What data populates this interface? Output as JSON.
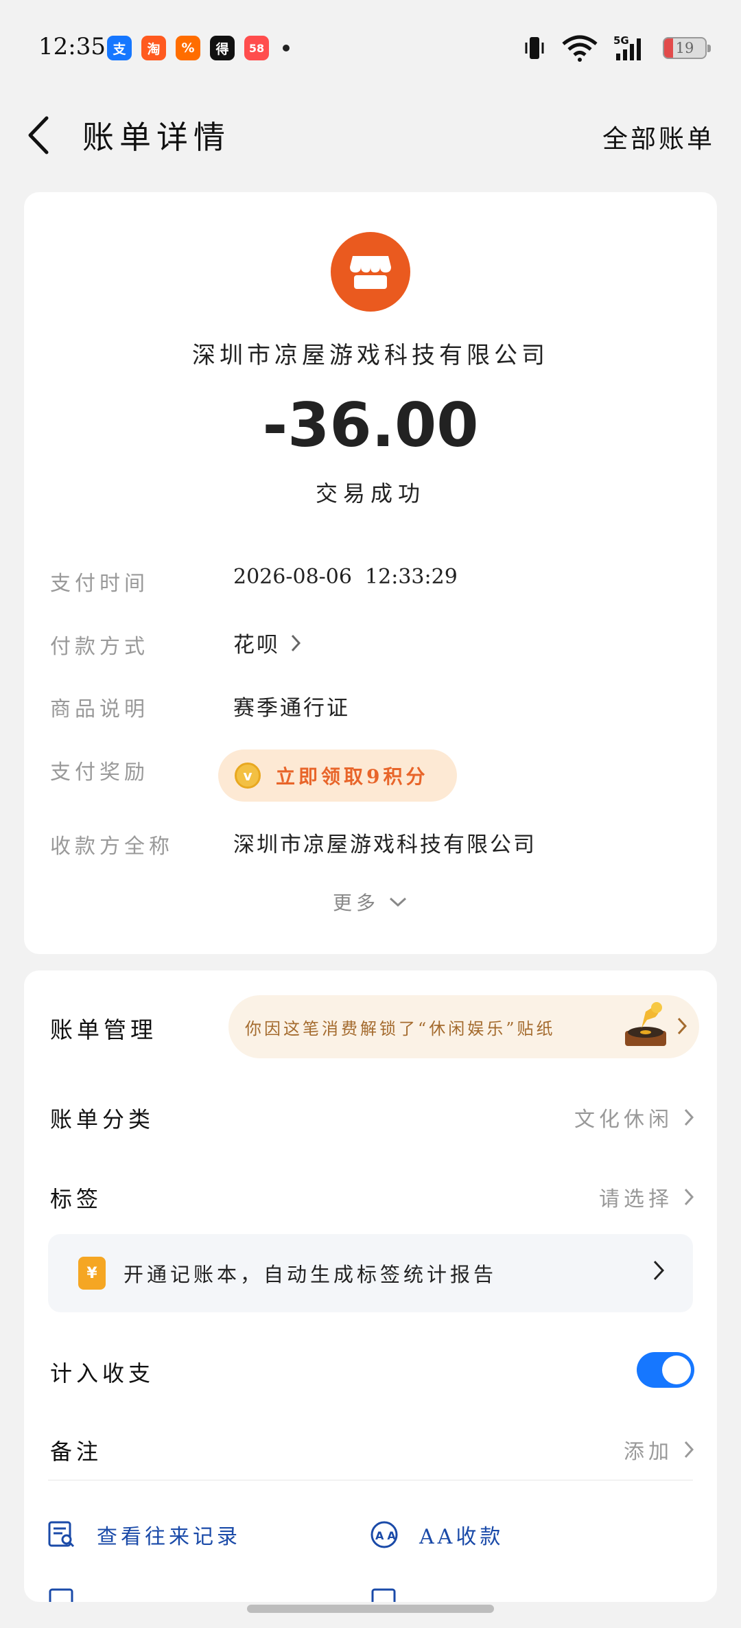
{
  "status_bar": {
    "time": "12:35",
    "notifications": [
      {
        "icon": "alipay-icon",
        "glyph": "支",
        "color": "#1677ff"
      },
      {
        "icon": "taobao-icon",
        "glyph": "淘",
        "color": "#ff5a1f"
      },
      {
        "icon": "promo-app-icon",
        "glyph": "%",
        "color": "#ff6d00"
      },
      {
        "icon": "app-icon",
        "glyph": "得",
        "color": "#111111"
      },
      {
        "icon": "58-app-icon",
        "glyph": "58",
        "color": "#ff4d4d"
      }
    ],
    "battery": "19"
  },
  "header": {
    "title": "账单详情",
    "right_link": "全部账单"
  },
  "summary": {
    "merchant": "深圳市凉屋游戏科技有限公司",
    "amount": "-36.00",
    "status": "交易成功"
  },
  "details": {
    "pay_time_label": "支付时间",
    "pay_time_value": "2026-08-06  12:33:29",
    "pay_method_label": "付款方式",
    "pay_method_value": "花呗",
    "product_label": "商品说明",
    "product_value": "赛季通行证",
    "reward_label": "支付奖励",
    "reward_value": "立即领取9积分",
    "payee_label": "收款方全称",
    "payee_value": "深圳市凉屋游戏科技有限公司",
    "more": "更多"
  },
  "manage": {
    "bill_manage_label": "账单管理",
    "sticker_text": "你因这笔消费解锁了“休闲娱乐”贴纸",
    "category_label": "账单分类",
    "category_value": "文化休闲",
    "tag_label": "标签",
    "tag_value": "请选择",
    "promo_text": "开通记账本，自动生成标签统计报告",
    "include_label": "计入收支",
    "include_enabled": true,
    "note_label": "备注",
    "note_value": "添加",
    "action_history": "查看往来记录",
    "action_aa": "AA收款"
  },
  "colors": {
    "accent_blue": "#1677ff",
    "merchant_orange": "#ea5a1f",
    "reward_orange": "#e8652a"
  }
}
